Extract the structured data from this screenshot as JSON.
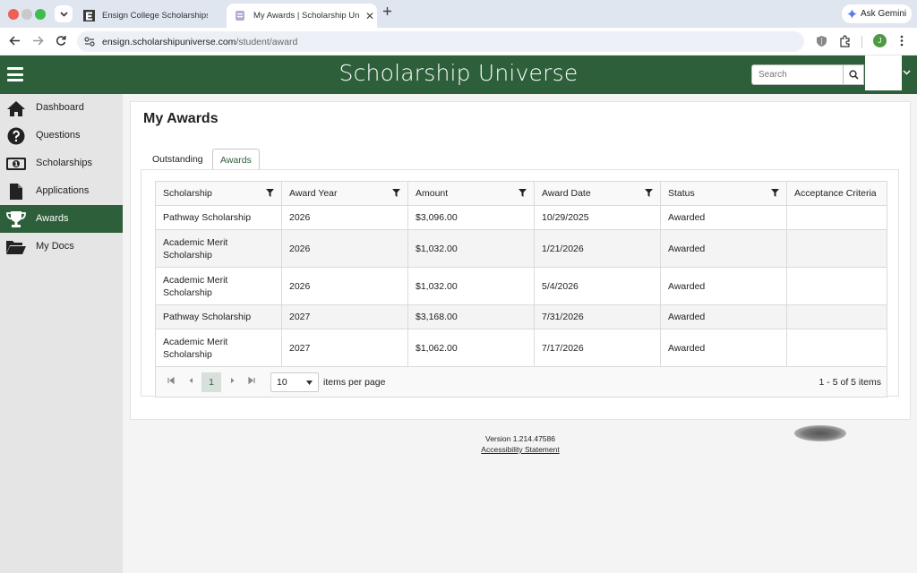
{
  "browser": {
    "tabs": [
      {
        "title": "Ensign College Scholarships |"
      },
      {
        "title": "My Awards | Scholarship Univ"
      }
    ],
    "ask_gemini": "Ask Gemini",
    "url_host": "ensign.scholarshipuniverse.com",
    "url_path": "/student/award",
    "profile_initial": "J"
  },
  "header": {
    "brand": "Scholarship Universe",
    "search_placeholder": "Search",
    "color": "#2d5f3a"
  },
  "sidebar": {
    "items": [
      {
        "label": "Dashboard",
        "icon": "home-icon"
      },
      {
        "label": "Questions",
        "icon": "question-icon"
      },
      {
        "label": "Scholarships",
        "icon": "money-icon"
      },
      {
        "label": "Applications",
        "icon": "document-icon"
      },
      {
        "label": "Awards",
        "icon": "trophy-icon",
        "active": true
      },
      {
        "label": "My Docs",
        "icon": "folder-open-icon"
      }
    ]
  },
  "main": {
    "title": "My Awards",
    "tabs": [
      {
        "label": "Outstanding"
      },
      {
        "label": "Awards",
        "selected": true
      }
    ],
    "grid": {
      "columns": [
        "Scholarship",
        "Award Year",
        "Amount",
        "Award Date",
        "Status",
        "Acceptance Criteria"
      ],
      "rows": [
        {
          "scholarship": "Pathway Scholarship",
          "year": "2026",
          "amount": "$3,096.00",
          "date": "10/29/2025",
          "status": "Awarded",
          "criteria": ""
        },
        {
          "scholarship": "Academic Merit Scholarship",
          "year": "2026",
          "amount": "$1,032.00",
          "date": "1/21/2026",
          "status": "Awarded",
          "criteria": ""
        },
        {
          "scholarship": "Academic Merit Scholarship",
          "year": "2026",
          "amount": "$1,032.00",
          "date": "5/4/2026",
          "status": "Awarded",
          "criteria": ""
        },
        {
          "scholarship": "Pathway Scholarship",
          "year": "2027",
          "amount": "$3,168.00",
          "date": "7/31/2026",
          "status": "Awarded",
          "criteria": ""
        },
        {
          "scholarship": "Academic Merit Scholarship",
          "year": "2027",
          "amount": "$1,062.00",
          "date": "7/17/2026",
          "status": "Awarded",
          "criteria": ""
        }
      ]
    },
    "pager": {
      "current_page": "1",
      "page_size": "10",
      "items_per_page_label": "items per page",
      "info": "1 - 5 of 5 items"
    }
  },
  "footer": {
    "version": "Version 1.214.47586",
    "accessibility": "Accessibility Statement"
  }
}
